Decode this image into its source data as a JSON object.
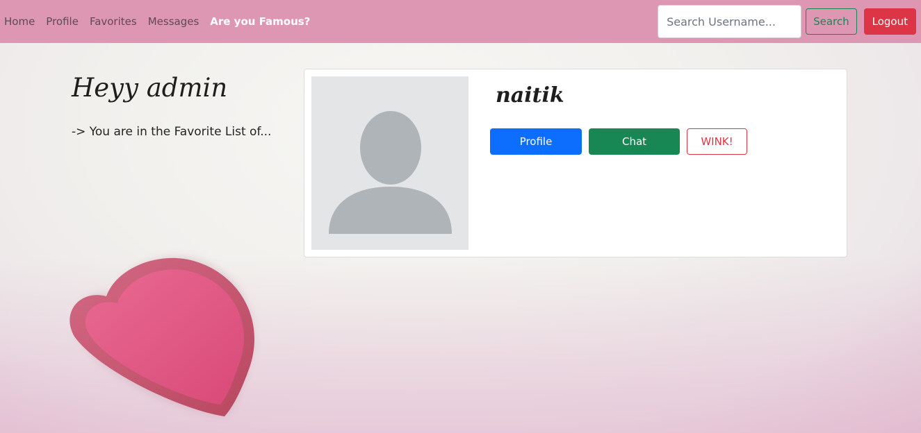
{
  "nav": {
    "links": [
      "Home",
      "Profile",
      "Favorites",
      "Messages"
    ],
    "highlight_link": "Are you Famous?",
    "search_placeholder": "Search Username...",
    "search_button": "Search",
    "logout_button": "Logout"
  },
  "page": {
    "greeting": "Heyy admin",
    "subtitle": "-> You are in the Favorite List of..."
  },
  "card": {
    "username": "naitik",
    "profile_button": "Profile",
    "chat_button": "Chat",
    "wink_button": "WINK!"
  },
  "icons": [
    "person-placeholder-icon",
    "heart-image"
  ],
  "colors": {
    "navbar": "#de97b3",
    "profile_button": "#0d6efd",
    "chat_button": "#198754",
    "logout_button": "#dc3545",
    "wink_outline": "#dc3545",
    "heart": "#e0577f"
  }
}
